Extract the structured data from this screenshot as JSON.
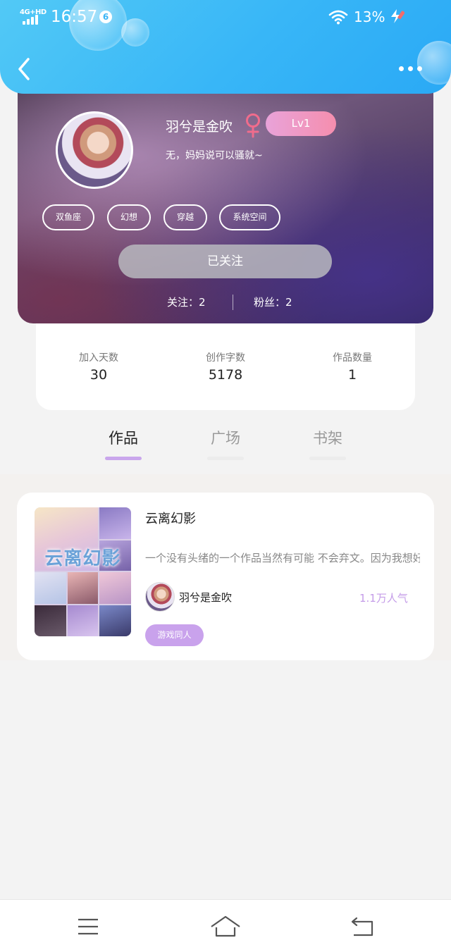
{
  "status_bar": {
    "network": "4G+HD",
    "time": "16:57",
    "notification_count": "6",
    "battery": "13%"
  },
  "header": {
    "back_icon": "chevron-left-icon",
    "more_icon": "more-dots-icon"
  },
  "profile": {
    "nickname": "羽兮是金吹",
    "gender_symbol": "♀",
    "level": "Lv1",
    "signature": "无，妈妈说可以骚就~",
    "tags": [
      "双鱼座",
      "幻想",
      "穿越",
      "系统空间"
    ],
    "follow_button": "已关注",
    "following": "关注：2",
    "followers": "粉丝：2"
  },
  "stats": [
    {
      "label": "加入天数",
      "value": "30"
    },
    {
      "label": "创作字数",
      "value": "5178"
    },
    {
      "label": "作品数量",
      "value": "1"
    }
  ],
  "tabs": [
    {
      "label": "作品",
      "active": true
    },
    {
      "label": "广场",
      "active": false
    },
    {
      "label": "书架",
      "active": false
    }
  ],
  "works": [
    {
      "title": "云离幻影",
      "cover_text": "云离幻影",
      "description": "一个没有头绪的一个作品当然有可能 不会弃文。因为我想好下去了",
      "author": "羽兮是金吹",
      "popularity": "1.1万人气",
      "genre": "游戏同人"
    }
  ],
  "bottom_nav": {
    "menu_icon": "menu-icon",
    "home_icon": "home-icon",
    "back_icon": "return-icon"
  },
  "colors": {
    "header_blue": "#38b6f7",
    "accent_purple": "#c9a6ec",
    "level_pink": "#f58eae",
    "gender_pink": "#f06c8c"
  }
}
